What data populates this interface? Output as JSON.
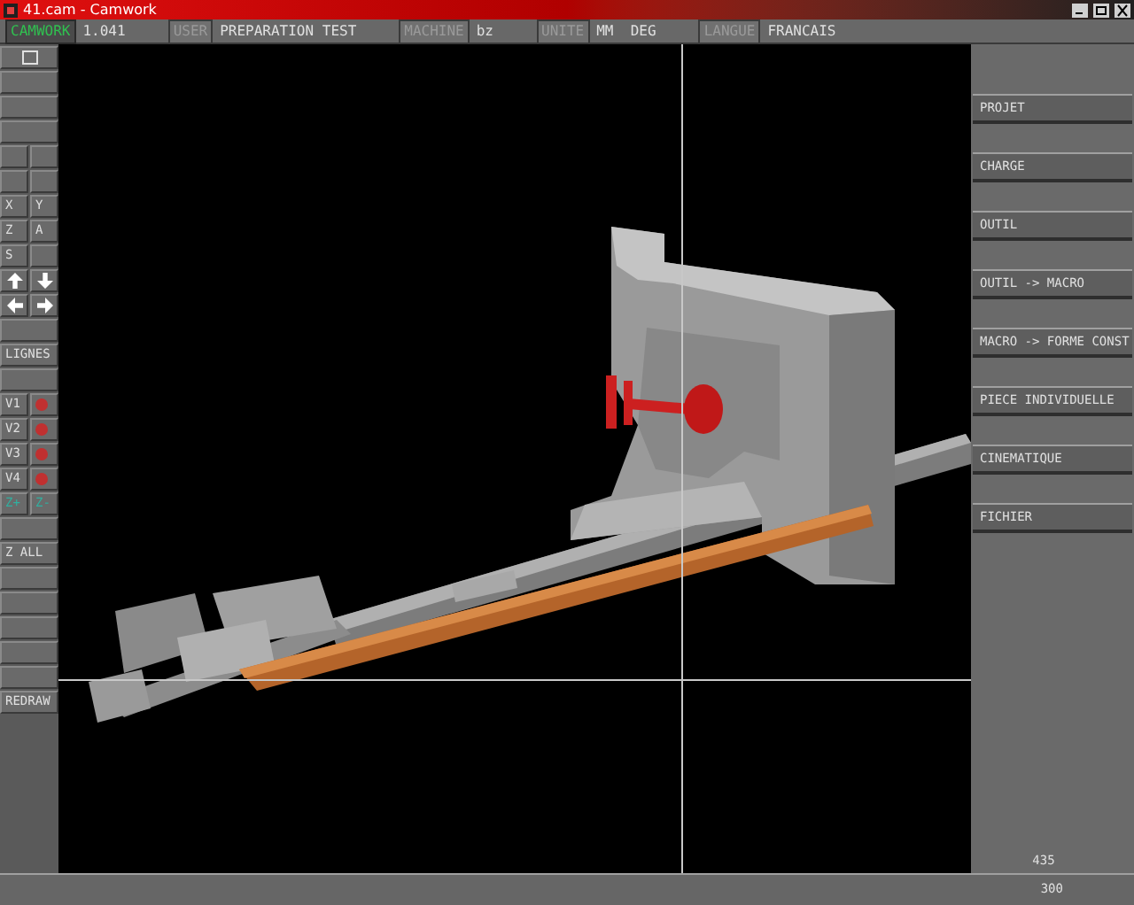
{
  "window": {
    "title": "41.cam - Camwork"
  },
  "toolbar": [
    {
      "kind": "brand",
      "text": "CAMWORK"
    },
    {
      "kind": "value",
      "text": "1.041"
    },
    {
      "kind": "label",
      "text": "USER"
    },
    {
      "kind": "value",
      "text": "PREPARATION TEST"
    },
    {
      "kind": "label",
      "text": "MACHINE"
    },
    {
      "kind": "value",
      "text": "bz"
    },
    {
      "kind": "label",
      "text": "UNITE"
    },
    {
      "kind": "value",
      "text": "MM  DEG"
    },
    {
      "kind": "label",
      "text": "LANGUE"
    },
    {
      "kind": "value",
      "text": "FRANCAIS"
    }
  ],
  "left_toolbar": [
    [
      {
        "kind": "frame"
      }
    ],
    [
      {
        "kind": "blank"
      }
    ],
    [
      {
        "kind": "blank"
      }
    ],
    [
      {
        "kind": "blank"
      }
    ],
    [
      {
        "kind": "blank"
      },
      {
        "kind": "blank"
      }
    ],
    [
      {
        "kind": "blank"
      },
      {
        "kind": "blank"
      }
    ],
    [
      {
        "kind": "text",
        "text": "X"
      },
      {
        "kind": "text",
        "text": "Y"
      }
    ],
    [
      {
        "kind": "text",
        "text": "Z"
      },
      {
        "kind": "text",
        "text": "A"
      }
    ],
    [
      {
        "kind": "text",
        "text": "S"
      },
      {
        "kind": "blank"
      }
    ],
    [
      {
        "kind": "up"
      },
      {
        "kind": "down"
      }
    ],
    [
      {
        "kind": "left"
      },
      {
        "kind": "right"
      }
    ],
    [
      {
        "kind": "blank"
      }
    ],
    [
      {
        "kind": "text",
        "text": "LIGNES"
      }
    ],
    [
      {
        "kind": "blank"
      }
    ],
    [
      {
        "kind": "text",
        "text": "V1"
      },
      {
        "kind": "dot",
        "color": "#c03030"
      }
    ],
    [
      {
        "kind": "text",
        "text": "V2"
      },
      {
        "kind": "dot",
        "color": "#c03030"
      }
    ],
    [
      {
        "kind": "text",
        "text": "V3"
      },
      {
        "kind": "dot",
        "color": "#c03030"
      }
    ],
    [
      {
        "kind": "text",
        "text": "V4"
      },
      {
        "kind": "dot",
        "color": "#c03030"
      }
    ],
    [
      {
        "kind": "text",
        "text": "Z+",
        "color": "#30b0a0"
      },
      {
        "kind": "text",
        "text": "Z-",
        "color": "#30b0a0"
      }
    ],
    [
      {
        "kind": "blank"
      }
    ],
    [
      {
        "kind": "text",
        "text": "Z ALL"
      }
    ],
    [
      {
        "kind": "blank"
      }
    ],
    [
      {
        "kind": "blank"
      }
    ],
    [
      {
        "kind": "blank"
      }
    ],
    [
      {
        "kind": "blank"
      }
    ],
    [
      {
        "kind": "blank"
      }
    ],
    [
      {
        "kind": "text",
        "text": "REDRAW"
      }
    ]
  ],
  "right_menu": [
    "PROJET",
    "CHARGE",
    "OUTIL",
    "OUTIL -> MACRO",
    "MACRO -> FORME CONST",
    "PIECE INDIVIDUELLE",
    "CINEMATIQUE",
    "FICHIER"
  ],
  "panel_reading": "435",
  "status_bar": {
    "reading": "300"
  }
}
